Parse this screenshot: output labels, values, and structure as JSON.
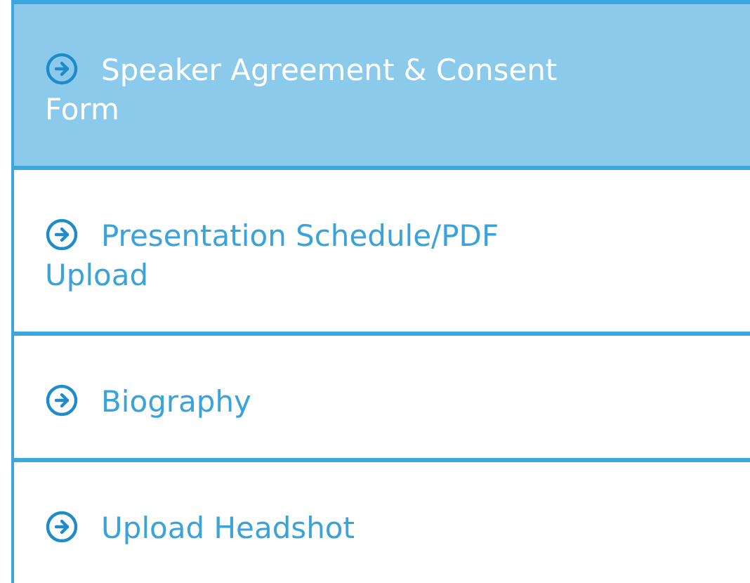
{
  "menu": [
    {
      "label": "Speaker Agreement & Consent Form",
      "selected": true
    },
    {
      "label": "Presentation Schedule/PDF Upload",
      "selected": false
    },
    {
      "label": "Biography",
      "selected": false
    },
    {
      "label": "Upload Headshot",
      "selected": false
    }
  ]
}
